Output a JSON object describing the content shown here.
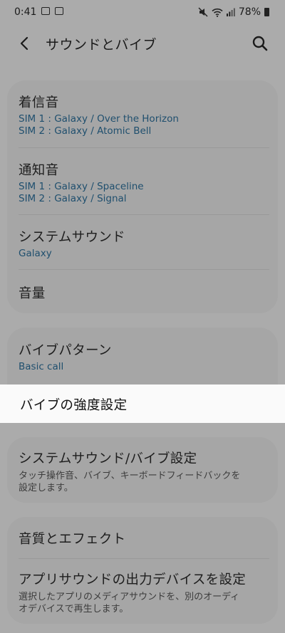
{
  "status_bar": {
    "time": "0:41",
    "battery": "78%",
    "icons": [
      "gallery-icon",
      "cast-icon",
      "mute-icon",
      "wifi-icon",
      "signal-icon",
      "battery-icon"
    ]
  },
  "header": {
    "title": "サウンドとバイブ",
    "back_icon": "chevron-left-icon",
    "search_icon": "search-icon"
  },
  "group1": [
    {
      "title": "着信音",
      "sub": [
        "SIM 1 : Galaxy / Over the Horizon",
        "SIM 2 : Galaxy / Atomic Bell"
      ]
    },
    {
      "title": "通知音",
      "sub": [
        "SIM 1 : Galaxy / Spaceline",
        "SIM 2 : Galaxy / Signal"
      ]
    },
    {
      "title": "システムサウンド",
      "sub": [
        "Galaxy"
      ]
    },
    {
      "title": "音量"
    }
  ],
  "group2": [
    {
      "title": "バイブパターン",
      "sub": [
        "Basic call"
      ]
    },
    {
      "title": "バイブの強度設定"
    }
  ],
  "group3": [
    {
      "title": "システムサウンド/バイブ設定",
      "desc": [
        "タッチ操作音、バイブ、キーボードフィードバックを",
        "設定します。"
      ]
    }
  ],
  "group4": [
    {
      "title": "音質とエフェクト"
    },
    {
      "title": "アプリサウンドの出力デバイスを設定",
      "desc": [
        "選択したアプリのメディアサウンドを、別のオーディ",
        "オデバイスで再生します。"
      ]
    }
  ],
  "colors": {
    "background": "#ababab",
    "subtext": "#1f4f6e",
    "highlight": "#fafafa"
  }
}
